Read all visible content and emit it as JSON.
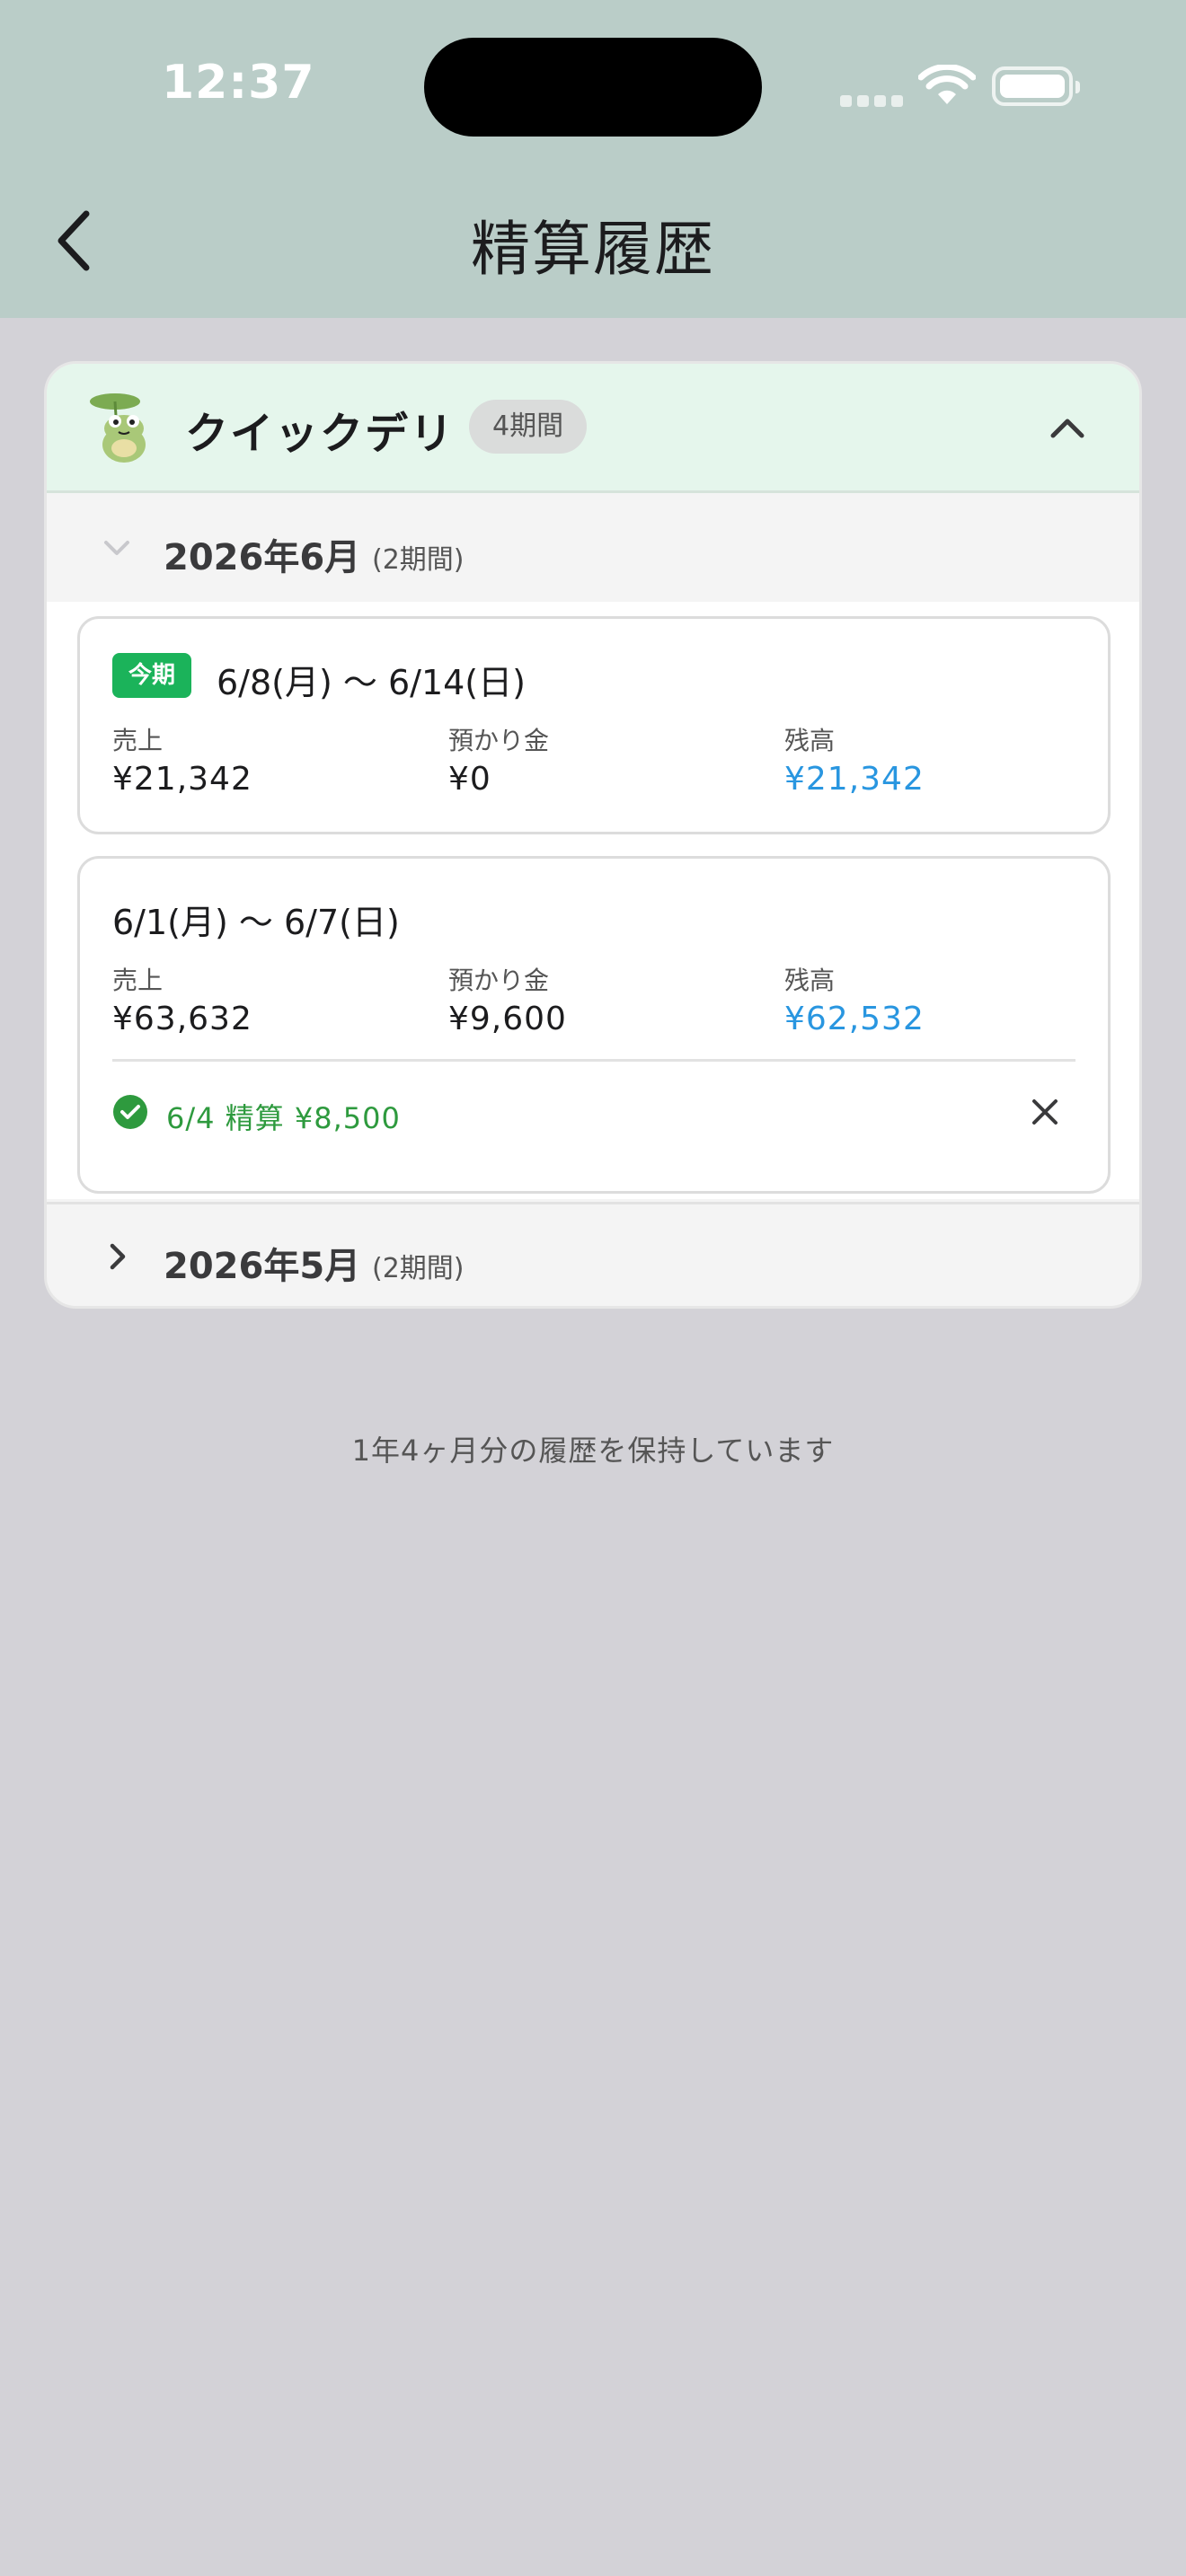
{
  "status_bar": {
    "time": "12:37"
  },
  "nav": {
    "title": "精算履歴"
  },
  "store": {
    "name": "クイックデリ",
    "period_badge": "4期間",
    "months": [
      {
        "label": "2026年6月",
        "count": "(2期間)",
        "expanded": true,
        "periods": [
          {
            "tag": "今期",
            "range": "6/8(月) 〜 6/14(日)",
            "sales_label": "売上",
            "sales": "¥21,342",
            "deposit_label": "預かり金",
            "deposit": "¥0",
            "balance_label": "残高",
            "balance": "¥21,342"
          },
          {
            "range": "6/1(月) 〜 6/7(日)",
            "sales_label": "売上",
            "sales": "¥63,632",
            "deposit_label": "預かり金",
            "deposit": "¥9,600",
            "balance_label": "残高",
            "balance": "¥62,532",
            "settlement": "6/4 精算 ¥8,500"
          }
        ]
      },
      {
        "label": "2026年5月",
        "count": "(2期間)",
        "expanded": false
      }
    ]
  },
  "footer": {
    "note": "1年4ヶ月分の履歴を保持しています"
  },
  "colors": {
    "header_bg": "#bacdc8",
    "store_header_bg": "#e5f6ec",
    "current_tag": "#1bb35a",
    "balance": "#2996e0",
    "settled": "#2e9a3e",
    "page_bg": "#d3d2d7"
  },
  "icons": {
    "back": "chevron-left-icon",
    "collapse": "chevron-up-icon",
    "month_expanded": "chevron-down-icon",
    "month_collapsed": "chevron-right-icon",
    "settled": "check-circle-icon",
    "delete": "close-icon",
    "store_avatar": "frog-icon"
  }
}
